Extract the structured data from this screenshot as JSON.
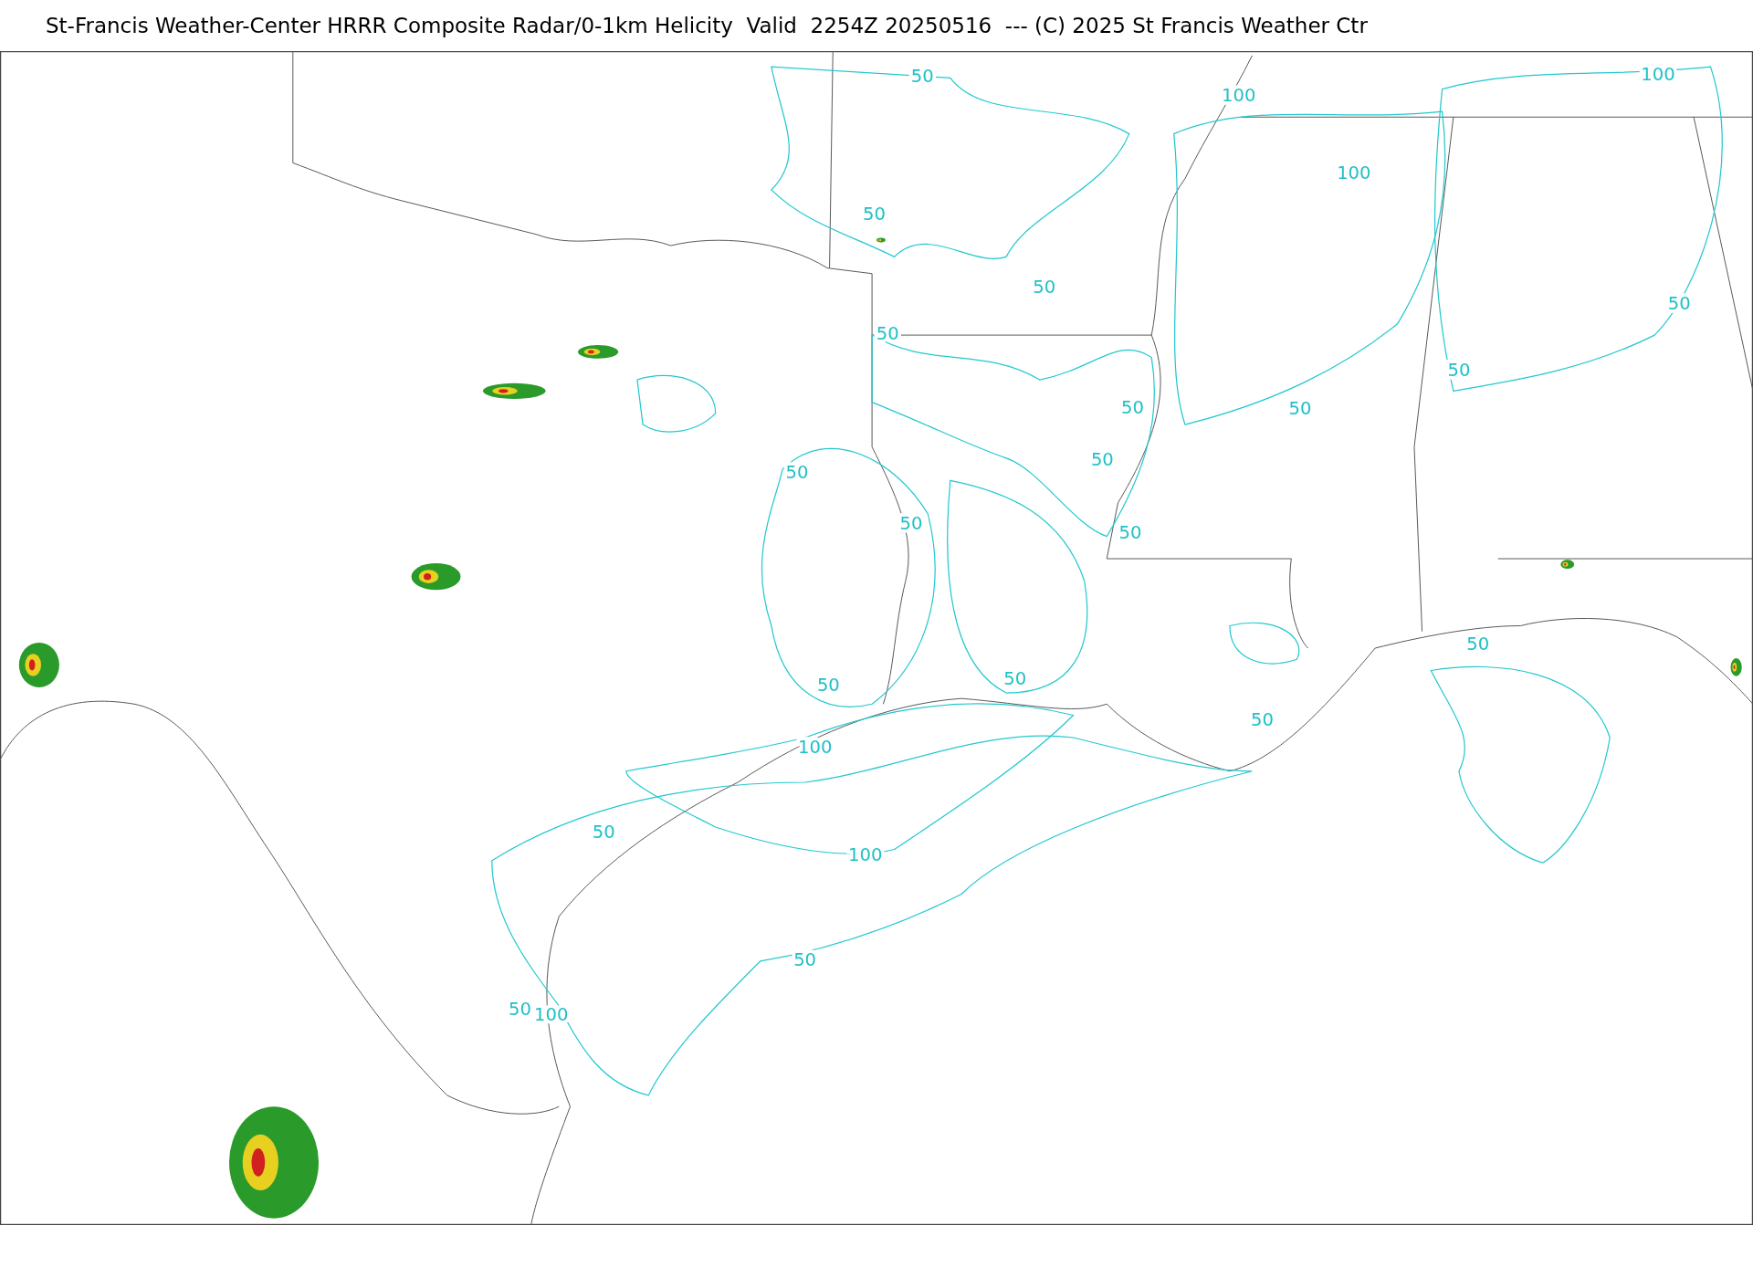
{
  "title": "St-Francis Weather-Center HRRR Composite Radar/0-1km Helicity  Valid  2254Z 20250516  --- (C) 2025 St Francis Weather Ctr",
  "map": {
    "contour_labels": [
      "50",
      "100",
      "100",
      "100",
      "50",
      "50",
      "50",
      "50",
      "50",
      "50",
      "50",
      "50",
      "50",
      "50",
      "50",
      "50",
      "50",
      "50",
      "50",
      "100",
      "50",
      "100",
      "50",
      "50",
      "100"
    ]
  }
}
